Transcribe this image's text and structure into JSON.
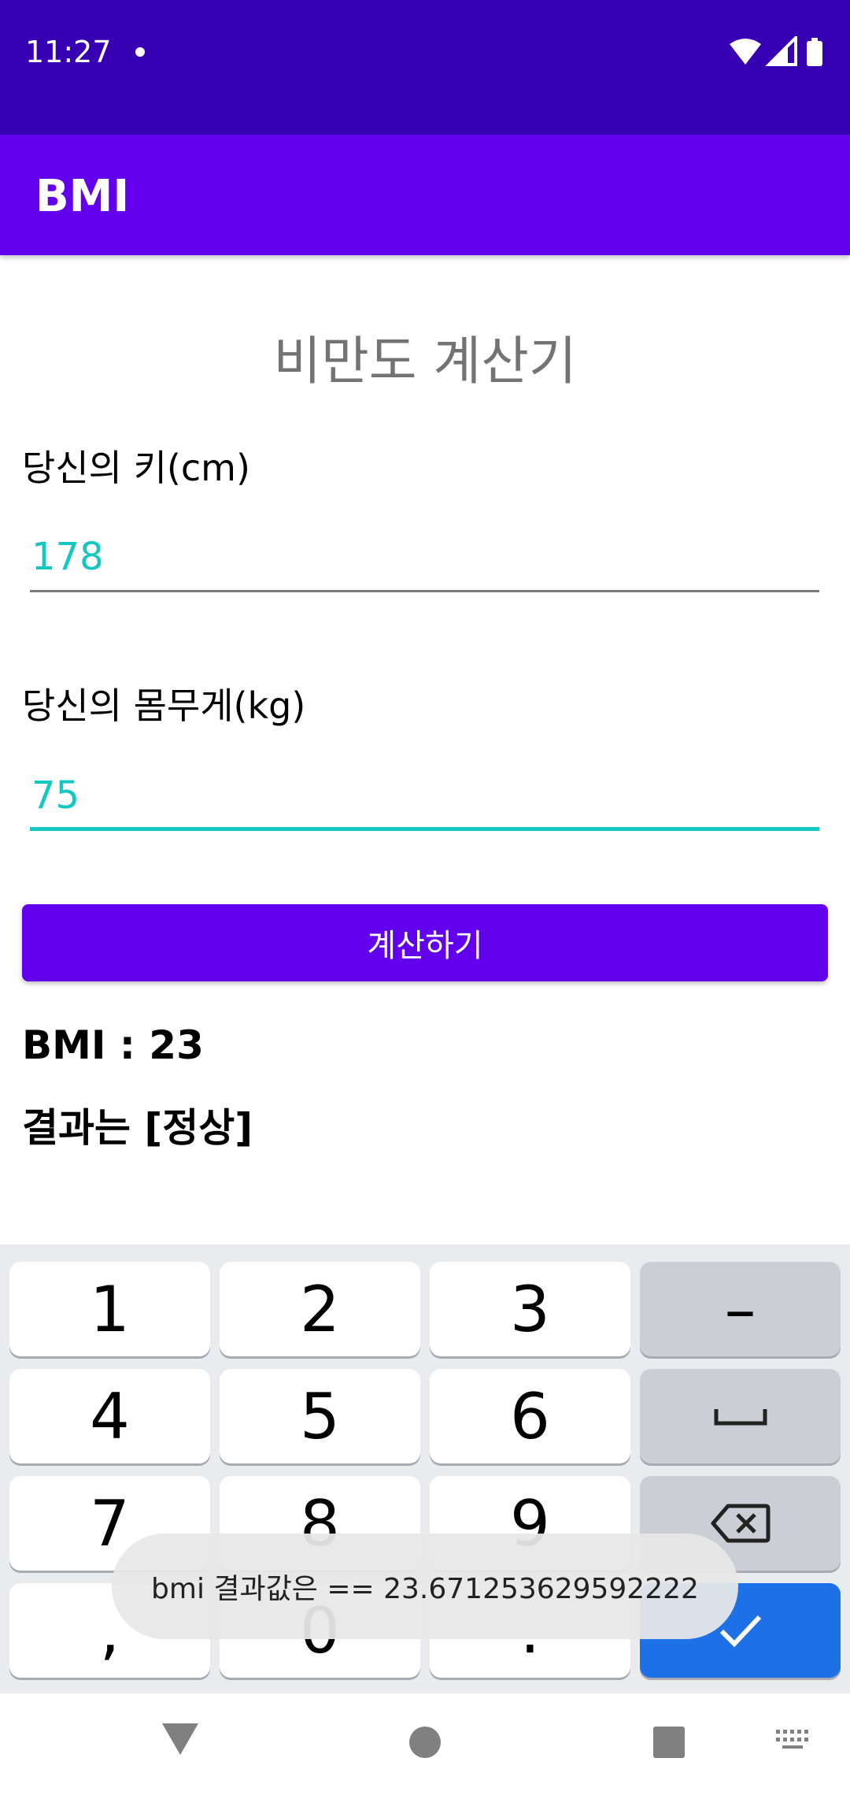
{
  "status_bar": {
    "time": "11:27"
  },
  "app_bar": {
    "title": "BMI"
  },
  "page": {
    "title": "비만도 계산기"
  },
  "height_field": {
    "label": "당신의 키(cm)",
    "value": "178"
  },
  "weight_field": {
    "label": "당신의 몸무게(kg)",
    "value": "75"
  },
  "calculate_button": {
    "label": "계산하기"
  },
  "results": {
    "bmi": "BMI : 23",
    "status": "결과는 [정상]"
  },
  "keyboard": {
    "keys": [
      "1",
      "2",
      "3",
      "–",
      "4",
      "5",
      "6",
      "7",
      "8",
      "9",
      ",",
      "0",
      "."
    ]
  },
  "toast": {
    "message": "bmi 결과값은 == 23.671253629592222"
  },
  "colors": {
    "accent": "#6200ee",
    "status_bar": "#3700b3",
    "input_accent": "#14c7c0",
    "keyboard_action": "#1d70e6"
  }
}
